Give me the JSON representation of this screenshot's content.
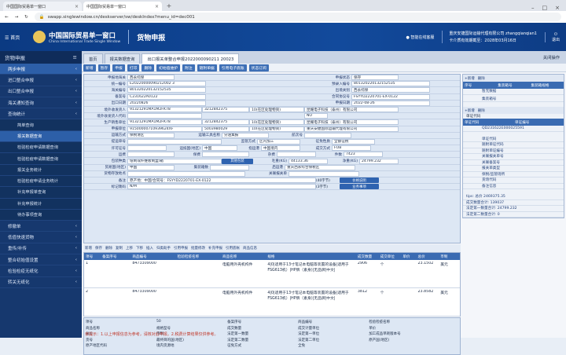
{
  "browser": {
    "tabs": [
      "中国国际贸易单一窗口",
      "中国国际贸易单一窗口"
    ],
    "url": "swapp.singlewindow.cn/deskserver/sw/deskIndex?menu_id=dec001"
  },
  "header": {
    "home": "首页",
    "brand_cn": "中国国际贸易单一窗口",
    "brand_en": "China International Trade Single Window",
    "system": "货物申报",
    "assistant": "智能在线客服",
    "company": "重庆安捷国际运输代理有限公司 zhangqianqian1",
    "card": "卡介质有效期截至：2028年03月16日",
    "exit": "退出"
  },
  "sidebar": {
    "title": "货物申报",
    "items": [
      {
        "label": "两步申报",
        "level": 1,
        "active": true
      },
      {
        "label": "进口整合申报",
        "level": 1
      },
      {
        "label": "出口整合申报",
        "level": 1
      },
      {
        "label": "海关通知查询",
        "level": 1
      },
      {
        "label": "查询统计",
        "level": 1
      },
      {
        "label": "简单查询",
        "level": 2
      },
      {
        "label": "报关数据查询",
        "level": 2,
        "active": true
      },
      {
        "label": "检验检疫申请数据查询",
        "level": 2
      },
      {
        "label": "检验检疫申请数据查询",
        "level": 2
      },
      {
        "label": "报关业务统计",
        "level": 2
      },
      {
        "label": "检验检疫申请业务统计",
        "level": 2
      },
      {
        "label": "补充申报单查询",
        "level": 2
      },
      {
        "label": "补充申报统计",
        "level": 2
      },
      {
        "label": "待办事项查询",
        "level": 2
      },
      {
        "label": "修撤单",
        "level": 1
      },
      {
        "label": "低值快速货物",
        "level": 1
      },
      {
        "label": "重传/补传",
        "level": 1
      },
      {
        "label": "整合初始值设置",
        "level": 1
      },
      {
        "label": "检验检疫无纸化",
        "level": 1
      },
      {
        "label": "转关无纸化",
        "level": 1
      }
    ]
  },
  "tabs": [
    "首页",
    "报关数据查询",
    "出口报关单整合申报2022000090211 20023"
  ],
  "close_tabs": "关闭操作",
  "toolbar": [
    "新增",
    "暂存",
    "申报",
    "打印",
    "删除",
    "初始值维护",
    "附注",
    "随附单据",
    "引用电子底账",
    "状态订阅"
  ],
  "form": {
    "declare_place_label": "申报地海关",
    "declare_place": "西永综保",
    "declare_status_label": "申报状态",
    "declare_status": "保存",
    "unified_no_label": "统一编号",
    "unified_no": "E20220000090212002 3",
    "preentry_no_label": "预录入编号",
    "preentry_no": "801320220132152535",
    "customs_no_label": "海关编号",
    "customs_no": "801320220132152535",
    "exit_port_label": "出境关别",
    "exit_port": "西永综保",
    "record_no_label": "备案号",
    "record_no": "C231622A0122",
    "contract_label": "合同协议号",
    "contract": "FSYYD2220701-EX-0122",
    "exit_date_label": "出口日期",
    "exit_date": "20220826",
    "apply_date_label": "申报日期",
    "apply_date": "2022-08-26",
    "consignee_label": "境外收发货人",
    "consignee_code": "91321291MA1M2FK78",
    "consignee_code2": "3212842375",
    "consignee_type": "10(在区处理物资)",
    "consignee_name": "昆耀电子科技（泰州）有限公司",
    "consignee_code3": "境外收发货人代码",
    "consignee_no": "NO",
    "producer_label": "生产销售单位",
    "producer_code": "91321291MA1M2FK78",
    "producer_code2": "3212842375",
    "producer_type": "10(在区处理物资)",
    "producer_name": "昆耀电子科技（泰州）有限公司",
    "agent_label": "申报单位",
    "agent_code": "91500000710939624XF",
    "agent_code2": "5003980029",
    "agent_type": "10(在区处理物资)",
    "agent_name": "重庆安捷国际运输代理有限公司",
    "transport_label": "运输方式",
    "transport": "保税港区",
    "ship_label": "运输工具名称",
    "ship": "分送集报",
    "voyage_label": "航次号",
    "bill_label": "提运单号",
    "trade_label": "监管方式",
    "trade": "区内加工",
    "tax_label": "征免性质",
    "tax": "全额征税",
    "permit_label": "许可证号",
    "dest_country_label": "运抵国(地区)",
    "dest_country": "中国",
    "port_label": "指运港",
    "port": "中国境内",
    "deal_label": "成交方式",
    "deal": "FOB",
    "freight_label": "运费",
    "premium_label": "保费",
    "misc_label": "杂费",
    "pieces_label": "件数",
    "pieces": "7423",
    "package_label": "包装种类",
    "package": "纸制或纤维板制盒/箱",
    "other_pack_btn": "其他包装",
    "gross_label": "毛重(KG)",
    "gross": "44133.36",
    "net_label": "净重(KG)",
    "net": "24799.232",
    "trade_country_label": "贸易国(地区)",
    "trade_country": "中国",
    "container_label": "集装箱数",
    "mark_label": "标记唛码",
    "mark": "N/M",
    "origin_label": "启运港",
    "origin_place": "重庆西永综合保税区",
    "supervise_label": "货物存放地点",
    "relation_label": "关联报关单",
    "remarks_label": "备注",
    "remarks": "原产地：中国/合同号：FSYYD2220701-EX-0122",
    "remarks_count": "(40字节)",
    "price_btn": "价格说明",
    "business_btn": "业务事项",
    "mark_count": "(3字节)"
  },
  "grid_toolbar": [
    "新增",
    "保存",
    "删除",
    "复制",
    "上移",
    "下移",
    "插入",
    "归类助手",
    "引用申报",
    "批量修改",
    "补充申报",
    "引用底帐",
    "商品信息"
  ],
  "grid": {
    "headers": [
      "项号",
      "备案序号",
      "商品编号",
      "检验检疫名称",
      "商品名称",
      "规格",
      "成交数量",
      "成交单位",
      "单价",
      "总价",
      "币制"
    ],
    "rows": [
      {
        "no": "1",
        "record": "8473309000",
        "name": "电脑用外壳机构件",
        "spec": "4|0|适用于13寸笔记本电脑等装置的设备|适用于FSG613机）|HP牌（素身)|无品牌|中文|",
        "qty": "2906",
        "unit": "个",
        "price": "",
        "total": "23.1502",
        "currency": "美元"
      },
      {
        "no": "2",
        "record": "8473309000",
        "name": "电脑用外壳机构件",
        "spec": "4|0|适用于13寸笔记本电脑等装置的设备|适用于FSG613机）|HP牌（素身)|无品牌|中文|",
        "qty": "3812",
        "unit": "个",
        "price": "",
        "total": "23.8582",
        "currency": "美元"
      }
    ]
  },
  "detail": {
    "fields": [
      "项号",
      "50",
      "备案序号",
      "商品编号",
      "检验检疫名称",
      "商品名称",
      "规格型号",
      "成交数量",
      "成交计量单位",
      "单价",
      "总价",
      "币制",
      "法定第一数量",
      "法定第一单位",
      "加工成品单耗版本号",
      "货号",
      "最终目的国(地区)",
      "法定第二数量",
      "法定第二单位",
      "原产国(地区)",
      "原产地区代码",
      "境内货源地",
      "征免方式",
      "全免"
    ]
  },
  "footnote": "亲提示：1.以上申报信息为参考，请核对后申报。2.税费计算结果仅供参考。",
  "right_panel": {
    "title1": "集装箱号",
    "cols1": [
      "序号",
      "集装箱号",
      "集装箱规格"
    ],
    "empty": "暂无数据",
    "title2": "单证代码",
    "cols2": [
      "单证代码",
      "单证编号"
    ],
    "cert_value": "QD231622E000025591",
    "labels": [
      "单证代码",
      "随附单证代码",
      "随附单证编号",
      "关联报关单号",
      "关联备案号",
      "报关单类型",
      "保税/监管场所",
      "货场代码",
      "备注信息"
    ],
    "stats": [
      "tips: 总价 2469375.35",
      "成交数量合计: 139037",
      "法定第一数量合计: 24799.232",
      "法定第二数量合计: 0"
    ]
  }
}
